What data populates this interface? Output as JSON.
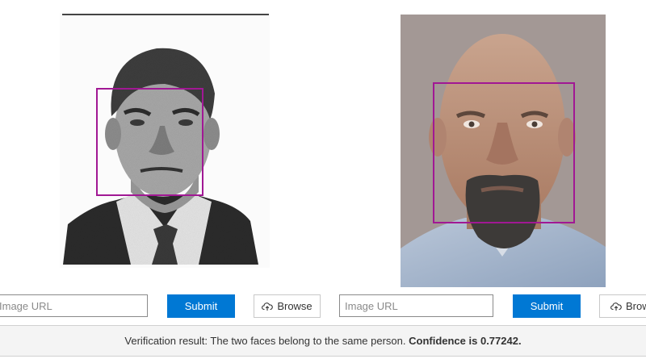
{
  "left_panel": {
    "image": {
      "kind": "scanned grayscale ID photo of a man in suit and tie"
    },
    "url_input": {
      "placeholder": "Image URL",
      "value": ""
    },
    "submit_label": "Submit",
    "browse_label": "Browse",
    "browse_icon": "cloud-upload-icon"
  },
  "right_panel": {
    "image": {
      "kind": "color photo of a bald man with goatee"
    },
    "url_input": {
      "placeholder": "Image URL",
      "value": ""
    },
    "submit_label": "Submit",
    "browse_label": "Browse",
    "browse_icon": "cloud-upload-icon"
  },
  "face_box_color": "#a11894",
  "accent_color": "#0078d4",
  "result": {
    "prefix": "Verification result: The two faces belong to the same person. ",
    "confidence_text": "Confidence is 0.77242."
  }
}
